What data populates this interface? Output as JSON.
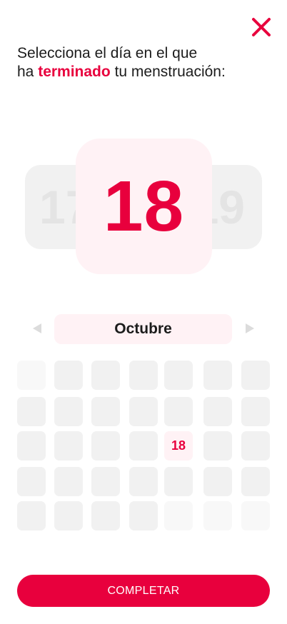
{
  "header": {
    "close_icon": "close-icon",
    "close_color": "#e8003d",
    "title_line1": "Selecciona el día en el que",
    "title_prefix": "ha",
    "title_accent": "terminado",
    "title_suffix": "tu menstruación:"
  },
  "picker": {
    "prev_day": "17",
    "selected_day": "18",
    "next_day": "19"
  },
  "month": {
    "label": "Octubre",
    "prev_icon": "triangle-left-icon",
    "next_icon": "triangle-right-icon"
  },
  "calendar": {
    "selected_label": "18",
    "cells": [
      {
        "state": "faint",
        "label": ""
      },
      {
        "state": "normal",
        "label": ""
      },
      {
        "state": "normal",
        "label": ""
      },
      {
        "state": "normal",
        "label": ""
      },
      {
        "state": "normal",
        "label": ""
      },
      {
        "state": "normal",
        "label": ""
      },
      {
        "state": "normal",
        "label": ""
      },
      {
        "state": "normal",
        "label": ""
      },
      {
        "state": "normal",
        "label": ""
      },
      {
        "state": "normal",
        "label": ""
      },
      {
        "state": "normal",
        "label": ""
      },
      {
        "state": "normal",
        "label": ""
      },
      {
        "state": "normal",
        "label": ""
      },
      {
        "state": "normal",
        "label": ""
      },
      {
        "state": "normal",
        "label": ""
      },
      {
        "state": "normal",
        "label": ""
      },
      {
        "state": "normal",
        "label": ""
      },
      {
        "state": "normal",
        "label": ""
      },
      {
        "state": "selected",
        "label": "18"
      },
      {
        "state": "normal",
        "label": ""
      },
      {
        "state": "normal",
        "label": ""
      },
      {
        "state": "normal",
        "label": ""
      },
      {
        "state": "normal",
        "label": ""
      },
      {
        "state": "normal",
        "label": ""
      },
      {
        "state": "normal",
        "label": ""
      },
      {
        "state": "normal",
        "label": ""
      },
      {
        "state": "normal",
        "label": ""
      },
      {
        "state": "normal",
        "label": ""
      },
      {
        "state": "normal",
        "label": ""
      },
      {
        "state": "normal",
        "label": ""
      },
      {
        "state": "normal",
        "label": ""
      },
      {
        "state": "normal",
        "label": ""
      },
      {
        "state": "faint",
        "label": ""
      },
      {
        "state": "faint",
        "label": ""
      },
      {
        "state": "faint",
        "label": ""
      }
    ]
  },
  "footer": {
    "complete_label": "COMPLETAR",
    "button_color": "#e8003d"
  }
}
